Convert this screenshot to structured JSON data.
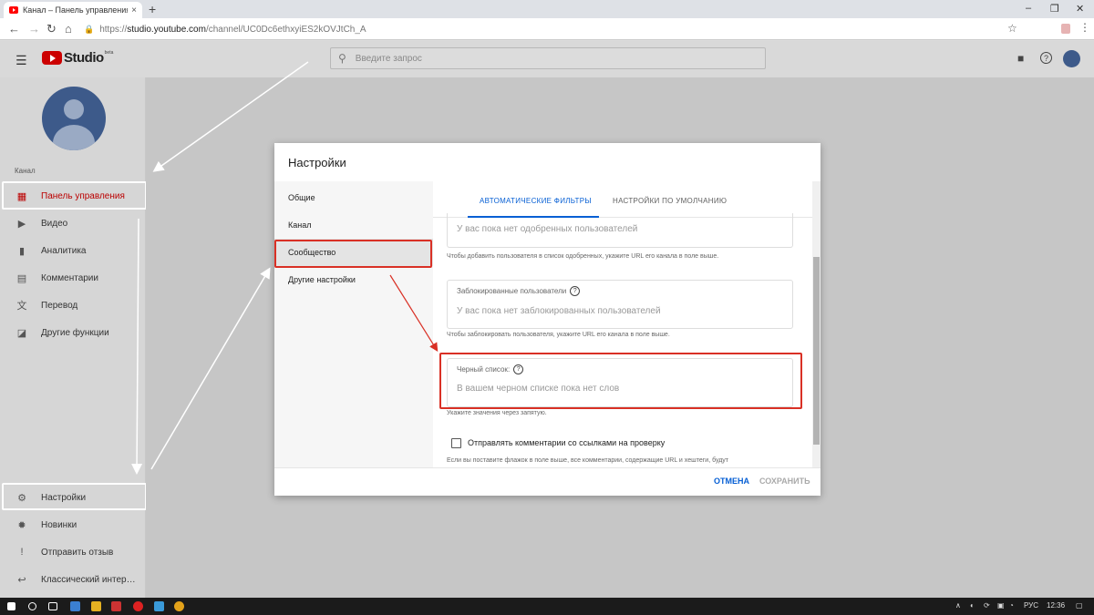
{
  "browser": {
    "tab_title": "Канал – Панель управления – Т",
    "tab_close": "×",
    "new_tab": "+",
    "url_prefix": "https://",
    "url_host": "studio.youtube.com",
    "url_path": "/channel/UC0Dc6ethxyiES2kOVJtCh_A",
    "minimize": "–",
    "restore": "❐",
    "close": "✕"
  },
  "header": {
    "logo_text": "Studio",
    "beta": "beta",
    "search_placeholder": "Введите запрос"
  },
  "sidebar": {
    "channel_label": "Канал",
    "items": [
      {
        "label": "Панель управления",
        "icon": "dashboard-icon",
        "active": true
      },
      {
        "label": "Видео",
        "icon": "video-icon"
      },
      {
        "label": "Аналитика",
        "icon": "analytics-icon"
      },
      {
        "label": "Комментарии",
        "icon": "comments-icon"
      },
      {
        "label": "Перевод",
        "icon": "translate-icon"
      },
      {
        "label": "Другие функции",
        "icon": "other-features-icon"
      }
    ],
    "bottom_items": [
      {
        "label": "Настройки",
        "icon": "gear-icon"
      },
      {
        "label": "Новинки",
        "icon": "whats-new-icon"
      },
      {
        "label": "Отправить отзыв",
        "icon": "feedback-icon"
      },
      {
        "label": "Классический интер…",
        "icon": "classic-icon"
      }
    ]
  },
  "dialog": {
    "title": "Настройки",
    "nav": [
      "Общие",
      "Канал",
      "Сообщество",
      "Другие настройки"
    ],
    "active_nav": "Сообщество",
    "tabs": [
      "АВТОМАТИЧЕСКИЕ ФИЛЬТРЫ",
      "НАСТРОЙКИ ПО УМОЛЧАНИЮ"
    ],
    "approved_placeholder": "У вас пока нет одобренных пользователей",
    "approved_hint": "Чтобы добавить пользователя в список одобренных, укажите URL его канала в поле выше.",
    "blocked_label": "Заблокированные пользователи",
    "blocked_placeholder": "У вас пока нет заблокированных пользователей",
    "blocked_hint": "Чтобы заблокировать пользователя, укажите URL его канала в поле выше.",
    "blacklist_label": "Черный список",
    "blacklist_placeholder": "В вашем черном списке пока нет слов",
    "blacklist_hint": "Укажите значения через запятую.",
    "checkbox_label": "Отправлять комментарии со ссылками на проверку",
    "checkbox_hint": "Если вы поставите флажок в поле выше, все комментарии, содержащие URL и хештеги, будут",
    "cancel": "ОТМЕНА",
    "save": "СОХРАНИТЬ"
  },
  "taskbar": {
    "lang": "РУС",
    "time": "12:36"
  },
  "colors": {
    "accent": "#065fd4",
    "highlight_red": "#d93025",
    "youtube_red": "#cc0000"
  }
}
